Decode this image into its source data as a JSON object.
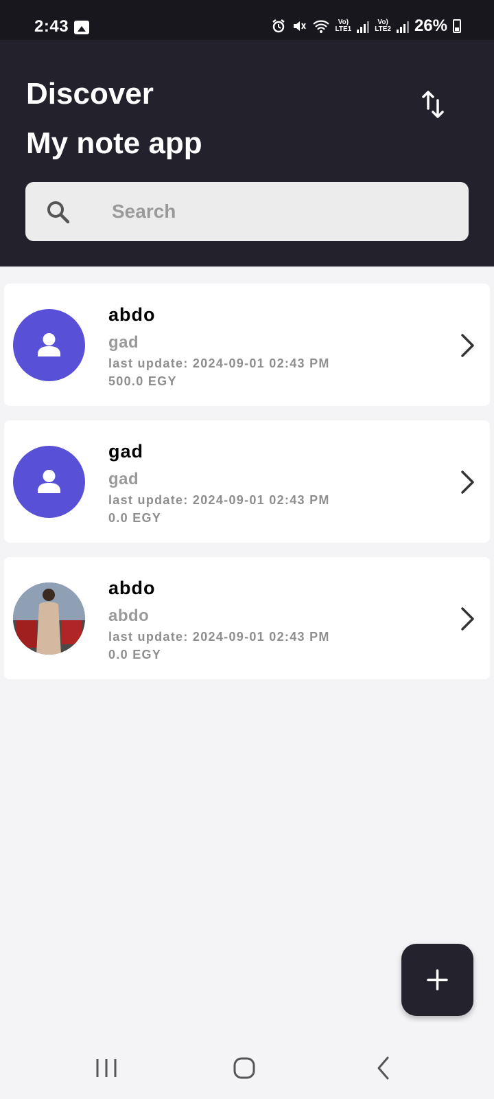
{
  "status_bar": {
    "time": "2:43",
    "battery": "26%",
    "network_labels": [
      "LTE1",
      "LTE2"
    ]
  },
  "header": {
    "title": "Discover",
    "subtitle": "My note app",
    "sort_icon": "swap-vertical-icon"
  },
  "search": {
    "placeholder": "Search",
    "value": "",
    "icon": "search-icon"
  },
  "notes": [
    {
      "name": "abdo",
      "subtitle": "gad",
      "last_update": "last update: 2024-09-01 02:43 PM",
      "amount": "500.0 EGY",
      "avatar": "default-person-avatar"
    },
    {
      "name": "gad",
      "subtitle": "gad",
      "last_update": "last update: 2024-09-01 02:43 PM",
      "amount": "0.0 EGY",
      "avatar": "default-person-avatar"
    },
    {
      "name": "abdo",
      "subtitle": "abdo",
      "last_update": "last update: 2024-09-01 02:43 PM",
      "amount": "0.0 EGY",
      "avatar": "photo-avatar"
    }
  ],
  "fab": {
    "icon": "plus-icon"
  },
  "colors": {
    "header_bg": "#22212c",
    "avatar_bg": "#5850d6",
    "page_bg": "#f4f4f6",
    "card_bg": "#ffffff",
    "fab_bg": "#23222d"
  },
  "nav_bar": {
    "buttons": [
      "recent-apps-icon",
      "home-icon",
      "back-icon"
    ]
  }
}
